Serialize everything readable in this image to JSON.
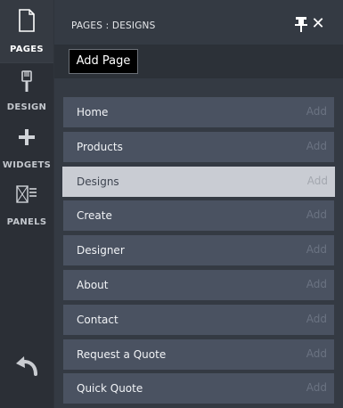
{
  "rail": {
    "items": [
      {
        "label": "PAGES",
        "icon": "page-icon",
        "active": true
      },
      {
        "label": "DESIGN",
        "icon": "paintbrush-icon",
        "active": false
      },
      {
        "label": "WIDGETS",
        "icon": "plus-icon",
        "active": false
      },
      {
        "label": "PANELS",
        "icon": "panels-icon",
        "active": false
      }
    ],
    "undo_icon": "undo-icon"
  },
  "panel": {
    "title": "PAGES : DESIGNS",
    "pin_icon": "pin-icon",
    "close_symbol": "✕",
    "add_page_label": "Add Page"
  },
  "pages": [
    {
      "name": "Home",
      "action": "Add",
      "selected": false
    },
    {
      "name": "Products",
      "action": "Add",
      "selected": false
    },
    {
      "name": "Designs",
      "action": "Add",
      "selected": true
    },
    {
      "name": "Create",
      "action": "Add",
      "selected": false
    },
    {
      "name": "Designer",
      "action": "Add",
      "selected": false
    },
    {
      "name": "About",
      "action": "Add",
      "selected": false
    },
    {
      "name": "Contact",
      "action": "Add",
      "selected": false
    },
    {
      "name": "Request a Quote",
      "action": "Add",
      "selected": false
    },
    {
      "name": "Quick Quote",
      "action": "Add",
      "selected": false
    }
  ],
  "colors": {
    "rail_bg": "#2b2f36",
    "panel_bg": "#343a43",
    "row_bg": "#4a5261",
    "row_selected_bg": "#c9ccd3",
    "button_bg": "#000000"
  }
}
